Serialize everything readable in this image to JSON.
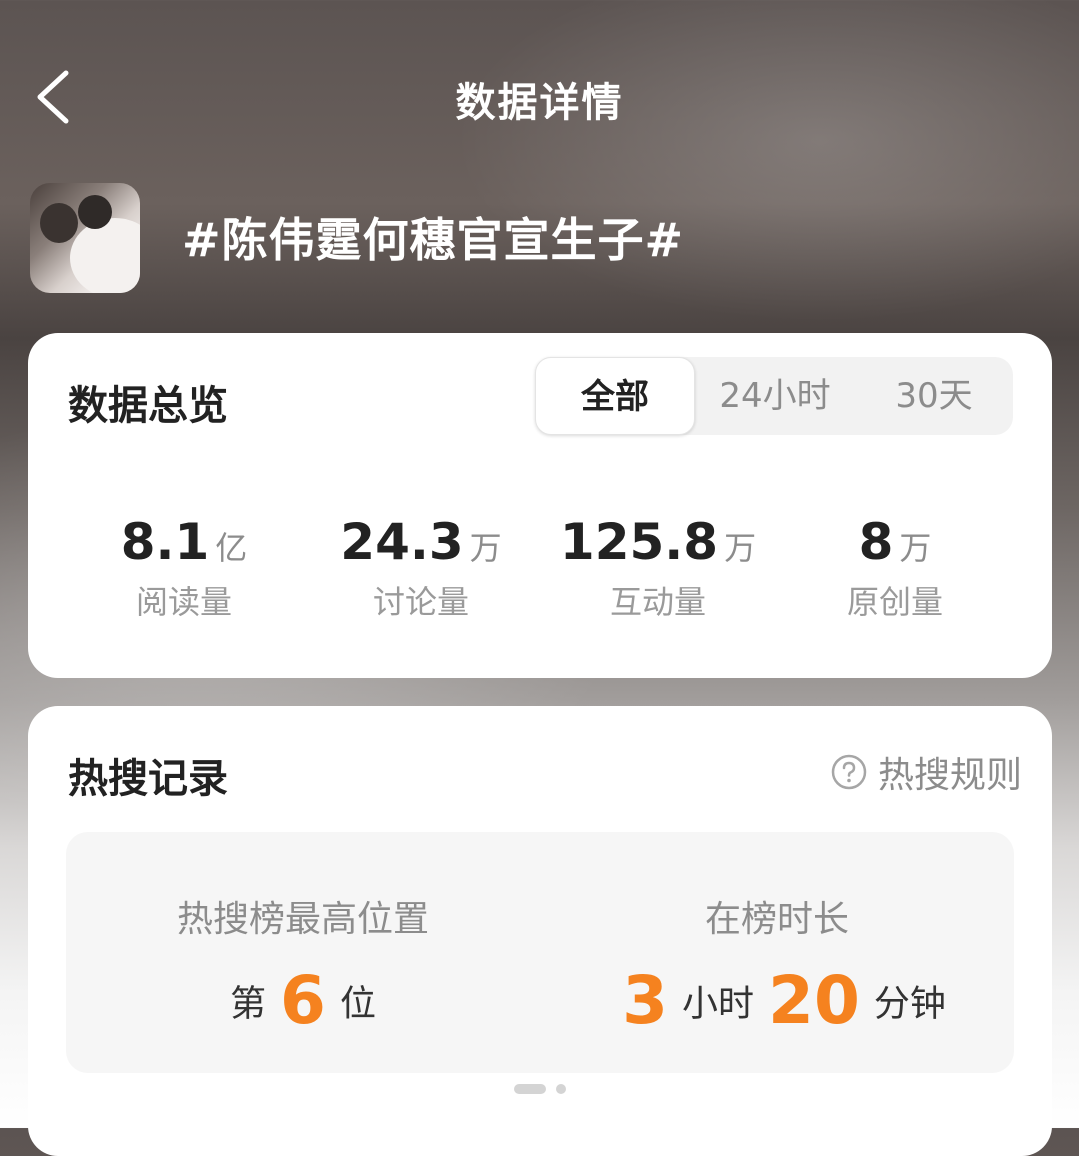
{
  "header": {
    "title": "数据详情"
  },
  "topic": {
    "title": "#陈伟霆何穗官宣生子#"
  },
  "overview": {
    "heading": "数据总览",
    "tabs": [
      {
        "label": "全部",
        "active": true
      },
      {
        "label": "24小时",
        "active": false
      },
      {
        "label": "30天",
        "active": false
      }
    ],
    "stats": [
      {
        "value": "8.1",
        "unit": "亿",
        "label": "阅读量"
      },
      {
        "value": "24.3",
        "unit": "万",
        "label": "讨论量"
      },
      {
        "value": "125.8",
        "unit": "万",
        "label": "互动量"
      },
      {
        "value": "8",
        "unit": "万",
        "label": "原创量"
      }
    ]
  },
  "hot_search": {
    "heading": "热搜记录",
    "rules_label": "热搜规则",
    "peak": {
      "label": "热搜榜最高位置",
      "prefix": "第",
      "value": "6",
      "suffix": "位"
    },
    "duration": {
      "label": "在榜时长",
      "hours": "3",
      "hours_unit": "小时",
      "minutes": "20",
      "minutes_unit": "分钟"
    }
  },
  "colors": {
    "accent": "#f5821f",
    "text_primary": "#222222",
    "text_secondary": "#8c8c8c"
  }
}
